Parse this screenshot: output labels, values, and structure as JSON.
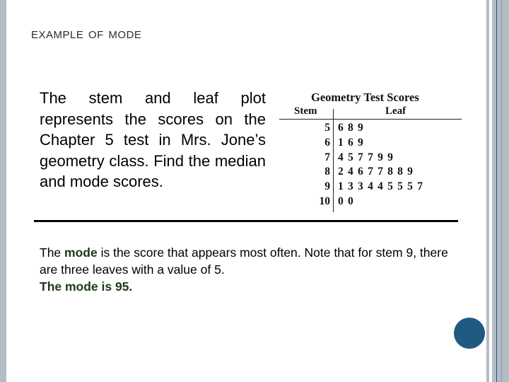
{
  "slide": {
    "title": "Example of Mode",
    "intro": "The stem and leaf plot represents the scores on the Chapter 5 test in Mrs. Jone’s geometry class. Find the median and mode scores.",
    "explanation": {
      "part1": "The ",
      "keyword": "mode",
      "part2": " is the score that appears most often. Note that for stem 9, there are three leaves with a value of 5.",
      "conclusion": "The mode is 95."
    },
    "accent_color": "#1f5a82",
    "keyword_color": "#1d3a17"
  },
  "chart_data": {
    "type": "table",
    "title": "Geometry Test Scores",
    "columns": [
      "Stem",
      "Leaf"
    ],
    "rows": [
      {
        "stem": "5",
        "leaves": "6 8 9"
      },
      {
        "stem": "6",
        "leaves": "1 6 9"
      },
      {
        "stem": "7",
        "leaves": "4 5 7 7 9 9"
      },
      {
        "stem": "8",
        "leaves": "2 4 6 7 7 8 8 9"
      },
      {
        "stem": "9",
        "leaves": "1 3 3 4 4 5 5 5 7"
      },
      {
        "stem": "10",
        "leaves": "0 0"
      }
    ]
  }
}
